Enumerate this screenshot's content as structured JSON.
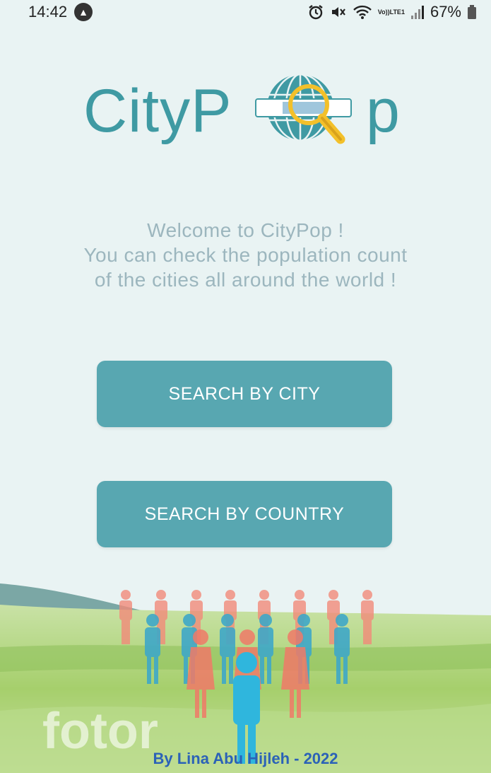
{
  "status_bar": {
    "time": "14:42",
    "network_top": "Vo))",
    "network_bottom": "LTE1",
    "battery": "67%"
  },
  "logo": {
    "text_left": "CityP",
    "text_right": "p"
  },
  "welcome": {
    "line1": "Welcome to CityPop !",
    "line2": "You can check the population count",
    "line3": "of the cities all around the world !"
  },
  "buttons": {
    "search_city": "SEARCH BY CITY",
    "search_country": "SEARCH BY COUNTRY"
  },
  "footer": {
    "credit": "By Lina Abu Hijleh - 2022",
    "watermark": "fotor"
  },
  "colors": {
    "accent": "#58a7b1",
    "logo": "#3f9aa3",
    "credit": "#2b62b7"
  }
}
